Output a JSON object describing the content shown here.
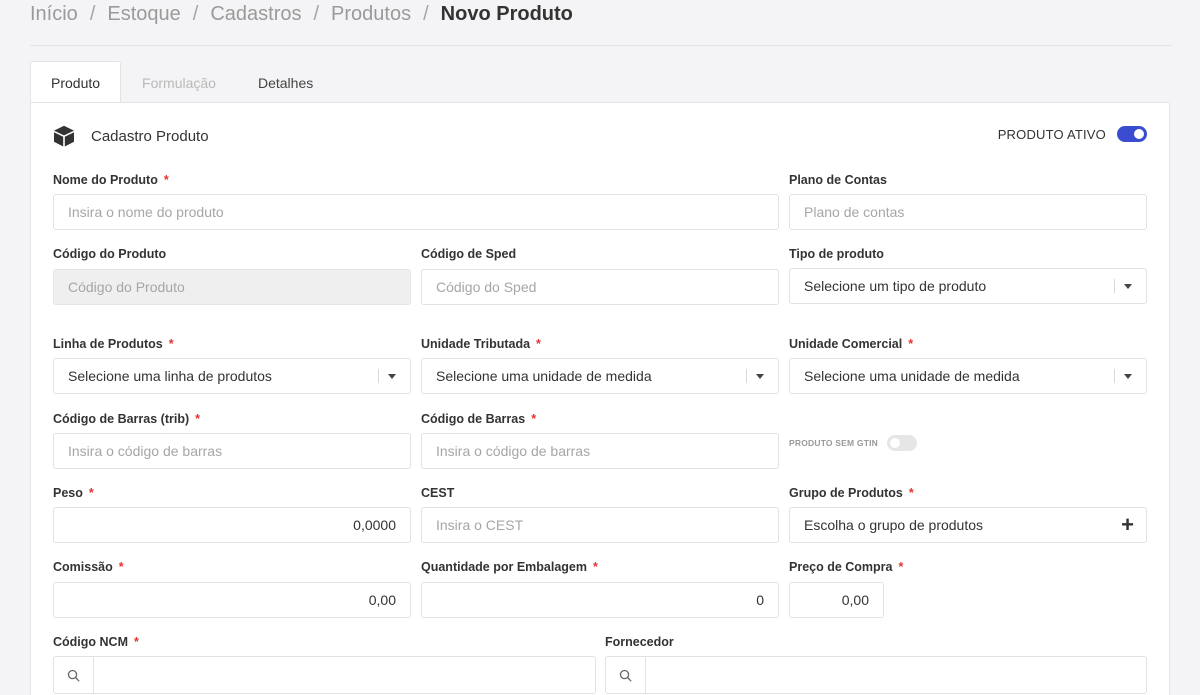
{
  "breadcrumb": {
    "items": [
      "Início",
      "Estoque",
      "Cadastros",
      "Produtos"
    ],
    "current": "Novo Produto",
    "separator": "/"
  },
  "tabs": [
    {
      "label": "Produto",
      "state": "active"
    },
    {
      "label": "Formulação",
      "state": "disabled"
    },
    {
      "label": "Detalhes",
      "state": "normal"
    }
  ],
  "section": {
    "title": "Cadastro Produto",
    "icon": "cube-icon"
  },
  "active_toggle": {
    "label": "PRODUTO ATIVO",
    "on": true,
    "color": "#3a4ccf"
  },
  "fields": {
    "nome_produto": {
      "label": "Nome do Produto",
      "required": "*",
      "placeholder": "Insira o nome do produto"
    },
    "plano_contas": {
      "label": "Plano de Contas",
      "placeholder": "Plano de contas"
    },
    "codigo_produto": {
      "label": "Código do Produto",
      "placeholder": "Código do Produto"
    },
    "codigo_sped": {
      "label": "Código de Sped",
      "placeholder": "Código do Sped"
    },
    "tipo_produto": {
      "label": "Tipo de produto",
      "value": "Selecione um tipo de produto"
    },
    "linha_produtos": {
      "label": "Linha de Produtos",
      "required": "*",
      "value": "Selecione uma linha de produtos"
    },
    "unidade_tributada": {
      "label": "Unidade Tributada",
      "required": "*",
      "value": "Selecione uma unidade de medida"
    },
    "unidade_comercial": {
      "label": "Unidade Comercial",
      "required": "*",
      "value": "Selecione uma unidade de medida"
    },
    "codigo_barras_trib": {
      "label": "Código de Barras (trib)",
      "required": "*",
      "placeholder": "Insira o código de barras"
    },
    "codigo_barras": {
      "label": "Código de Barras",
      "required": "*",
      "placeholder": "Insira o código de barras"
    },
    "produto_sem_gtin": {
      "label": "PRODUTO SEM GTIN",
      "on": false
    },
    "peso": {
      "label": "Peso",
      "required": "*",
      "value": "0,0000"
    },
    "cest": {
      "label": "CEST",
      "placeholder": "Insira o CEST"
    },
    "grupo_produtos": {
      "label": "Grupo de Produtos",
      "required": "*",
      "value": "Escolha o grupo de produtos",
      "icon": "plus-icon"
    },
    "comissao": {
      "label": "Comissão",
      "required": "*",
      "value": "0,00"
    },
    "qtd_embalagem": {
      "label": "Quantidade por Embalagem",
      "required": "*",
      "value": "0"
    },
    "preco_compra": {
      "label": "Preço de Compra",
      "required": "*",
      "value": "0,00"
    },
    "codigo_ncm": {
      "label": "Código NCM",
      "required": "*",
      "icon": "search-icon"
    },
    "fornecedor": {
      "label": "Fornecedor",
      "icon": "search-icon"
    }
  }
}
